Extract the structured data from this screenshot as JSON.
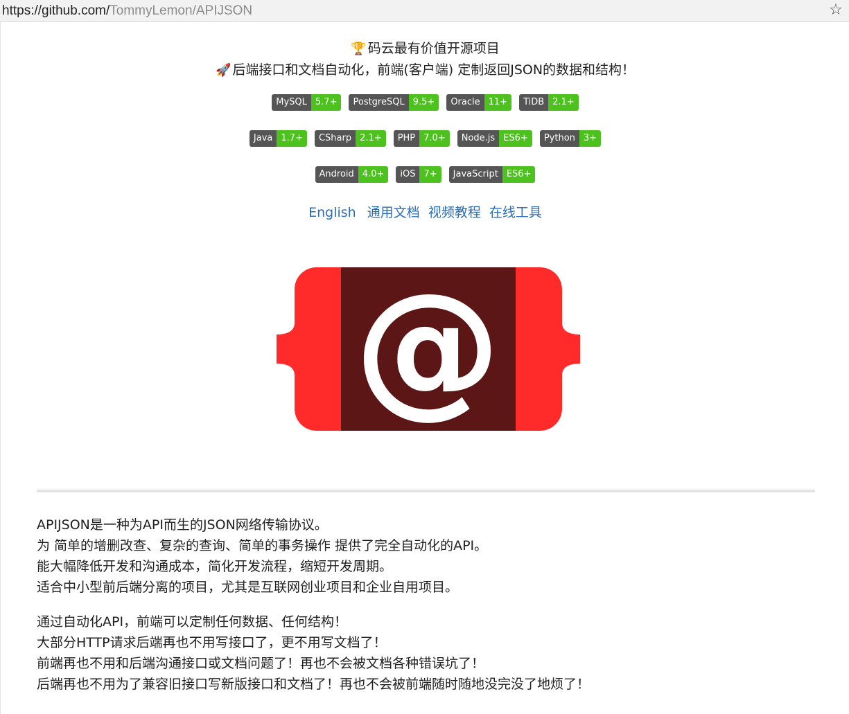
{
  "browser": {
    "url_host": "https://github.com/",
    "url_path": "TommyLemon/APIJSON",
    "bookmark_icon": "star-outline-icon"
  },
  "header": {
    "line1_emoji": "🏆",
    "line1_text": "码云最有价值开源项目",
    "line2_emoji": "🚀",
    "line2_text": "后端接口和文档自动化，前端(客户端) 定制返回JSON的数据和结构！"
  },
  "badges": {
    "row1": [
      {
        "label": "MySQL",
        "value": "5.7+"
      },
      {
        "label": "PostgreSQL",
        "value": "9.5+"
      },
      {
        "label": "Oracle",
        "value": "11+"
      },
      {
        "label": "TiDB",
        "value": "2.1+"
      }
    ],
    "row2": [
      {
        "label": "Java",
        "value": "1.7+"
      },
      {
        "label": "CSharp",
        "value": "2.1+"
      },
      {
        "label": "PHP",
        "value": "7.0+"
      },
      {
        "label": "Node.js",
        "value": "ES6+"
      },
      {
        "label": "Python",
        "value": "3+"
      }
    ],
    "row3": [
      {
        "label": "Android",
        "value": "4.0+"
      },
      {
        "label": "iOS",
        "value": "7+"
      },
      {
        "label": "JavaScript",
        "value": "ES6+"
      }
    ],
    "colors": {
      "label_bg": "#555555",
      "value_bg": "#4dc21f"
    }
  },
  "links": {
    "english": "English",
    "docs": "通用文档",
    "video": "视频教程",
    "tools": "在线工具",
    "color": "#2a6ebb"
  },
  "logo": {
    "symbol": "@",
    "colors": {
      "brace": "#ff2b2b",
      "center": "#5c1616",
      "at": "#ffffff"
    }
  },
  "intro": {
    "paragraph1": [
      "APIJSON是一种为API而生的JSON网络传输协议。",
      "为 简单的增删改查、复杂的查询、简单的事务操作 提供了完全自动化的API。",
      "能大幅降低开发和沟通成本，简化开发流程，缩短开发周期。",
      "适合中小型前后端分离的项目，尤其是互联网创业项目和企业自用项目。"
    ],
    "paragraph2": [
      "通过自动化API，前端可以定制任何数据、任何结构！",
      "大部分HTTP请求后端再也不用写接口了，更不用写文档了！",
      "前端再也不用和后端沟通接口或文档问题了！再也不会被文档各种错误坑了！",
      "后端再也不用为了兼容旧接口写新版接口和文档了！再也不会被前端随时随地没完没了地烦了！"
    ]
  }
}
